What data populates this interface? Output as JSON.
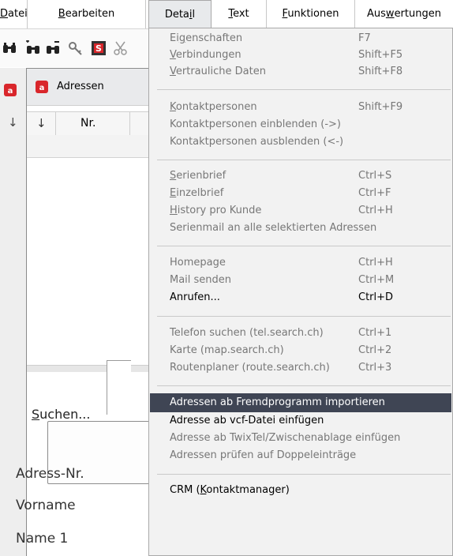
{
  "menubar": {
    "items": [
      {
        "pre": "",
        "u": "D",
        "post": "atei"
      },
      {
        "pre": "",
        "u": "B",
        "post": "earbeiten"
      },
      {
        "pre": "Deta",
        "u": "i",
        "post": "l"
      },
      {
        "pre": "",
        "u": "T",
        "post": "ext"
      },
      {
        "pre": "",
        "u": "F",
        "post": "unktionen"
      },
      {
        "pre": "Aus",
        "u": "w",
        "post": "ertungen"
      }
    ],
    "active_index": 2
  },
  "window": {
    "title": "Adressen",
    "column_nr": "Nr.",
    "sort_arrow": "↓",
    "search_button": {
      "u": "S",
      "post": "uchen..."
    },
    "labels": [
      "Adress-Nr.",
      "Vorname",
      "Name 1"
    ]
  },
  "menu": {
    "groups": [
      [
        {
          "pre": "Ei",
          "u": "g",
          "post": "enschaften",
          "key": "F7",
          "enabled": false
        },
        {
          "pre": "",
          "u": "V",
          "post": "erbindungen",
          "key": "Shift+F5",
          "enabled": false
        },
        {
          "pre": "",
          "u": "V",
          "post": "ertrauliche Daten",
          "key": "Shift+F8",
          "enabled": false
        }
      ],
      [
        {
          "pre": "",
          "u": "K",
          "post": "ontaktpersonen",
          "key": "Shift+F9",
          "enabled": false
        },
        {
          "pre": "",
          "u": "",
          "post": "Kontaktpersonen einblenden (->)",
          "key": "",
          "enabled": false
        },
        {
          "pre": "",
          "u": "",
          "post": "Kontaktpersonen ausblenden (<-)",
          "key": "",
          "enabled": false
        }
      ],
      [
        {
          "pre": "",
          "u": "S",
          "post": "erienbrief",
          "key": "Ctrl+S",
          "enabled": false
        },
        {
          "pre": "",
          "u": "E",
          "post": "inzelbrief",
          "key": "Ctrl+F",
          "enabled": false
        },
        {
          "pre": "",
          "u": "H",
          "post": "istory pro Kunde",
          "key": "Ctrl+H",
          "enabled": false
        },
        {
          "pre": "",
          "u": "",
          "post": "Serienmail an alle selektierten Adressen",
          "key": "",
          "enabled": false
        }
      ],
      [
        {
          "pre": "",
          "u": "",
          "post": "Homepage",
          "key": "Ctrl+H",
          "enabled": false
        },
        {
          "pre": "",
          "u": "",
          "post": "Mail senden",
          "key": "Ctrl+M",
          "enabled": false
        },
        {
          "pre": "",
          "u": "",
          "post": "Anrufen...",
          "key": "Ctrl+D",
          "enabled": true
        }
      ],
      [
        {
          "pre": "",
          "u": "",
          "post": "Telefon suchen (tel.search.ch)",
          "key": "Ctrl+1",
          "enabled": false
        },
        {
          "pre": "",
          "u": "",
          "post": "Karte (map.search.ch)",
          "key": "Ctrl+2",
          "enabled": false
        },
        {
          "pre": "",
          "u": "",
          "post": "Routenplaner (route.search.ch)",
          "key": "Ctrl+3",
          "enabled": false
        }
      ],
      [
        {
          "pre": "",
          "u": "",
          "post": "Adressen ab Fremdprogramm importieren",
          "key": "",
          "enabled": true,
          "highlighted": true
        },
        {
          "pre": "",
          "u": "",
          "post": "Adresse ab vcf-Datei einfügen",
          "key": "",
          "enabled": true
        },
        {
          "pre": "",
          "u": "",
          "post": "Adresse ab TwixTel/Zwischenablage einfügen",
          "key": "",
          "enabled": false
        },
        {
          "pre": "",
          "u": "",
          "post": "Adressen prüfen auf Doppeleinträge",
          "key": "",
          "enabled": false
        }
      ],
      [
        {
          "pre": "CRM (",
          "u": "K",
          "post": "ontaktmanager)",
          "key": "",
          "enabled": true
        }
      ]
    ]
  },
  "colors": {
    "highlight": "#3f4554",
    "disabled_text": "#777777",
    "menu_bg": "#f2f2f2",
    "logo_red": "#d9262b"
  },
  "icons": [
    "binoculars-icon",
    "binoculars-plus-icon",
    "binoculars-minus-icon",
    "key-filter-icon",
    "s-badge-icon",
    "scissors-icon",
    "app-logo-icon"
  ]
}
